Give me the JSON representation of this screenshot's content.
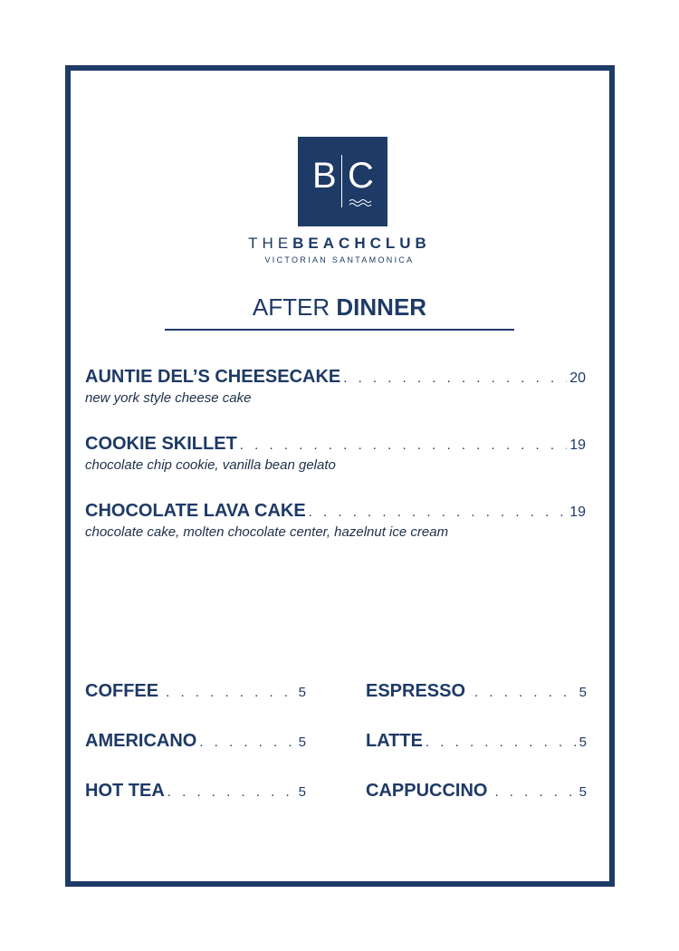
{
  "brand": {
    "logo_letters": [
      "B",
      "C"
    ],
    "name_light": "THE",
    "name_bold": "BEACHCLUB",
    "subtitle": "VICTORIAN SANTAMONICA",
    "brand_color": "#1e3a66"
  },
  "section": {
    "title_light": "AFTER",
    "title_bold": "DINNER"
  },
  "desserts": [
    {
      "name": "AUNTIE DEL’S CHEESECAKE",
      "price": "20",
      "description": "new york style cheese cake"
    },
    {
      "name": "COOKIE SKILLET",
      "price": "19",
      "description": "chocolate chip cookie, vanilla bean gelato"
    },
    {
      "name": "CHOCOLATE LAVA CAKE",
      "price": "19",
      "description": "chocolate cake, molten chocolate center, hazelnut ice cream"
    }
  ],
  "beverages": {
    "left": [
      {
        "name": "COFFEE",
        "price": "5"
      },
      {
        "name": "AMERICANO",
        "price": "5"
      },
      {
        "name": "HOT TEA",
        "price": "5"
      }
    ],
    "right": [
      {
        "name": "ESPRESSO",
        "price": "5"
      },
      {
        "name": "LATTE",
        "price": "5"
      },
      {
        "name": "CAPPUCCINO",
        "price": "5"
      }
    ]
  }
}
